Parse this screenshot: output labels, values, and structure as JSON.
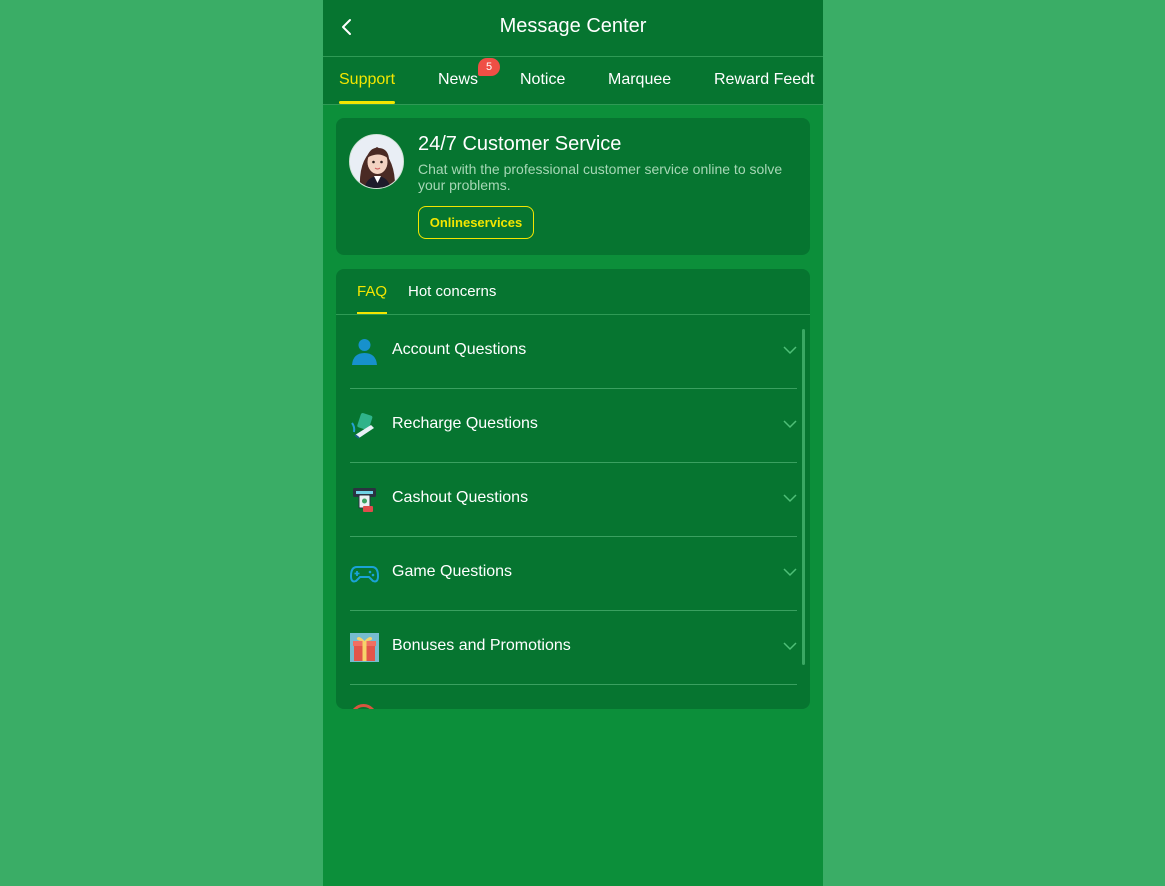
{
  "header": {
    "title": "Message Center"
  },
  "tabs": [
    {
      "label": "Support"
    },
    {
      "label": "News",
      "badge": "5"
    },
    {
      "label": "Notice"
    },
    {
      "label": "Marquee"
    },
    {
      "label": "Reward Feedt"
    }
  ],
  "support_card": {
    "title": "24/7 Customer Service",
    "description": "Chat with the professional customer service online to solve your problems.",
    "button_label": "Onlineservices"
  },
  "faq": {
    "tabs": [
      {
        "label": "FAQ"
      },
      {
        "label": "Hot concerns"
      }
    ],
    "items": [
      {
        "label": "Account Questions",
        "icon": "user-icon"
      },
      {
        "label": "Recharge Questions",
        "icon": "recharge-icon"
      },
      {
        "label": "Cashout Questions",
        "icon": "atm-icon"
      },
      {
        "label": "Game Questions",
        "icon": "gamepad-icon"
      },
      {
        "label": "Bonuses and Promotions",
        "icon": "gift-icon"
      }
    ]
  },
  "colors": {
    "page_background": "#3aad66",
    "panel": "#067530",
    "content_background": "#0c8f3a",
    "accent_yellow": "#f3e600",
    "badge_red": "#ef4f45"
  }
}
